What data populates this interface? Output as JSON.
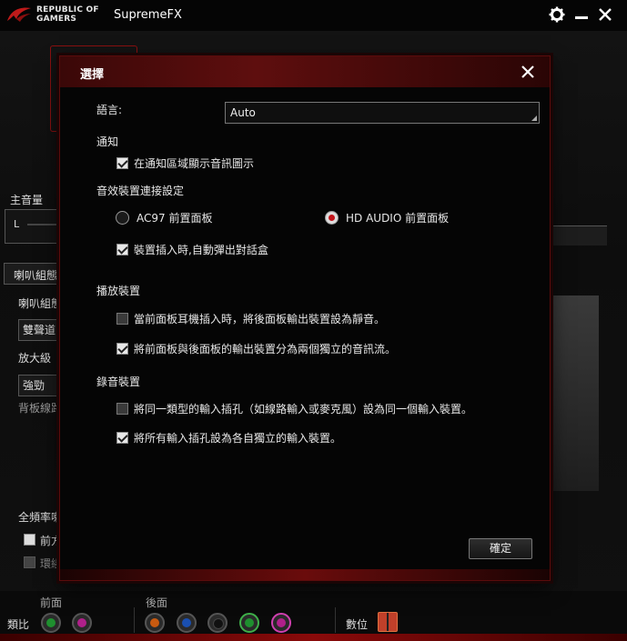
{
  "app": {
    "brand_line1": "REPUBLIC OF",
    "brand_line2": "GAMERS",
    "title": "SupremeFX",
    "settings_icon": "gear-icon",
    "minimize_icon": "minimize-icon",
    "close_icon": "close-icon"
  },
  "background": {
    "master_volume_label": "主音量",
    "channel_left": "L",
    "speaker_tab": "喇叭組態",
    "speaker_config_label": "喇叭組態",
    "speaker_config_value": "雙聲道",
    "amplifier_label": "放大級",
    "amplifier_value": "強勁",
    "rear_panel_label": "背板線路",
    "fullrange_label": "全頻率喇叭",
    "front_check_label": "前方",
    "surround_check_label": "環繞",
    "front_label": "前面",
    "rear_label": "後面",
    "analog_label": "類比",
    "digital_label": "數位"
  },
  "dialog": {
    "title": "選擇",
    "language_label": "語言:",
    "language_value": "Auto",
    "notify_section": "通知",
    "notify_tray": "在通知區域顯示音訊圖示",
    "device_section": "音效裝置連接設定",
    "radio_ac97": "AC97 前置面板",
    "radio_hd": "HD AUDIO 前置面板",
    "auto_popup": "裝置插入時,自動彈出對話盒",
    "playback_section": "播放裝置",
    "mute_rear": "當前面板耳機插入時，將後面板輸出裝置設為靜音。",
    "split_streams": "將前面板與後面板的輸出裝置分為兩個獨立的音訊流。",
    "record_section": "錄音裝置",
    "same_type_inputs": "將同一類型的輸入插孔（如線路輸入或麥克風）設為同一個輸入裝置。",
    "separate_inputs": "將所有輸入插孔設為各自獨立的輸入裝置。",
    "ok_label": "確定"
  },
  "state": {
    "notify_tray": true,
    "device_mode": "HD AUDIO",
    "auto_popup": true,
    "mute_rear": false,
    "split_streams": true,
    "same_type_inputs": false,
    "separate_inputs": true
  },
  "colors": {
    "accent_red": "#c2141a",
    "header_red": "#5e0e0e"
  }
}
